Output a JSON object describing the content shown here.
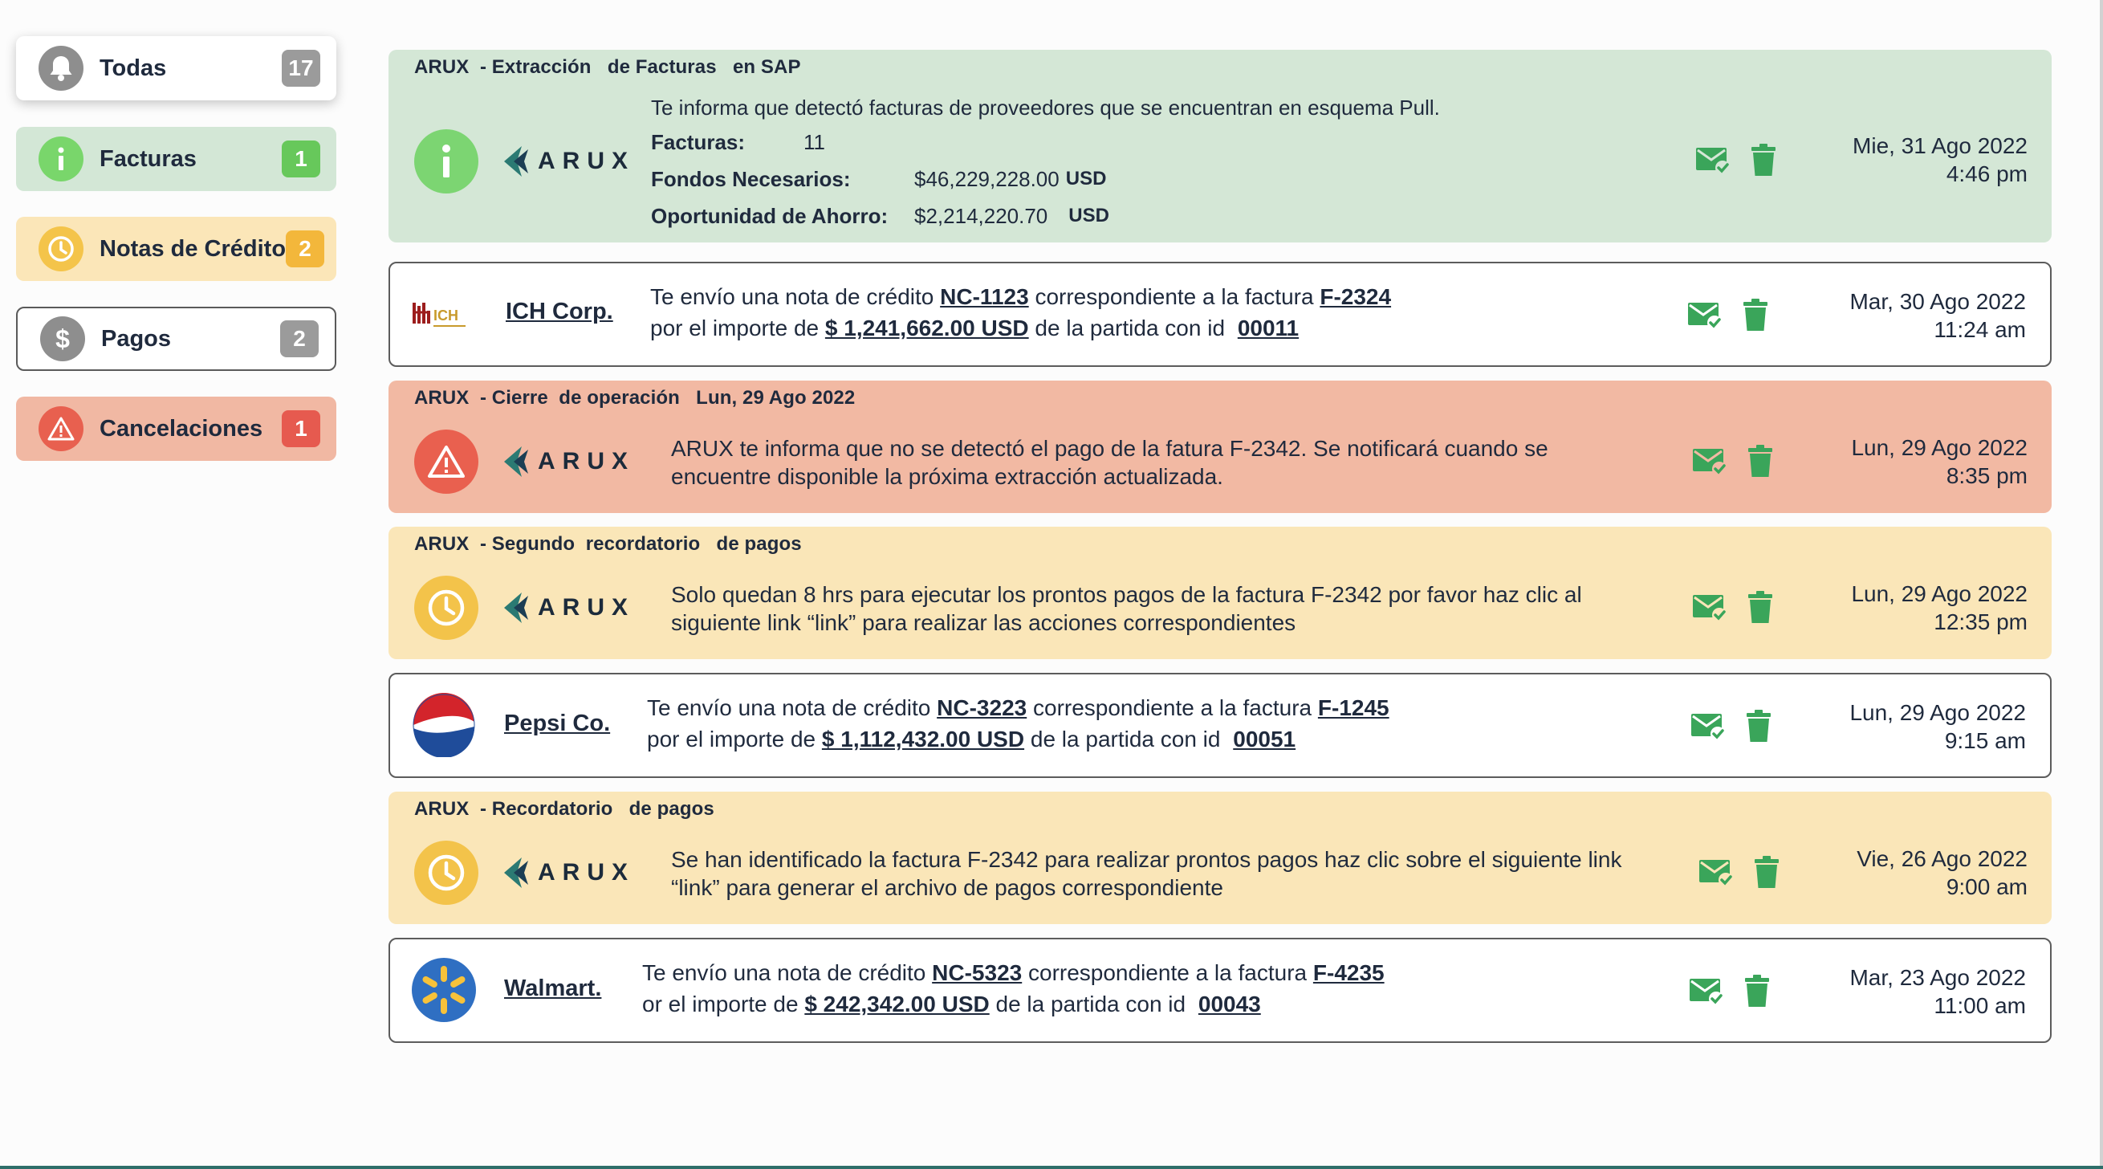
{
  "sidebar": {
    "filters": [
      {
        "label": "Todas",
        "count": "17"
      },
      {
        "label": "Facturas",
        "count": "1"
      },
      {
        "label": "Notas de Crédito",
        "count": "2"
      },
      {
        "label": "Pagos",
        "count": "2"
      },
      {
        "label": "Cancelaciones",
        "count": "1"
      }
    ]
  },
  "colors": {
    "green_bg": "#d4e7d6",
    "red_bg": "#f2b9a3",
    "yellow_bg": "#fae6b8",
    "action_green": "#3aa55a",
    "info_icon": "#7cd572",
    "warning_icon": "#e9604f",
    "clock_icon": "#f3c34a"
  },
  "notifications": [
    {
      "type": "factura",
      "header": "ARUX  - Extracción   de Facturas   en SAP",
      "logo": "ARUX",
      "intro": "Te informa que detectó facturas de proveedores que se encuentran en esquema Pull.",
      "details": [
        {
          "label": "Facturas:",
          "value": "11",
          "unit": ""
        },
        {
          "label": "Fondos Necesarios:",
          "value": "$46,229,228.00",
          "unit": "USD"
        },
        {
          "label": "Oportunidad de Ahorro:",
          "value": "$2,214,220.70",
          "unit": "USD"
        }
      ],
      "date": "Mie, 31 Ago 2022",
      "time": "4:46 pm",
      "icon": "info-icon"
    },
    {
      "type": "nota_credito",
      "company": "ICH Corp.",
      "logo_text": "ICH",
      "l1_pre": "Te envío una nota de crédito ",
      "note_id": "NC-1123",
      "l1_mid": " correspondiente a la factura ",
      "invoice_id": "F-2324",
      "l2_pre": "por el importe de ",
      "amount": "$ 1,241,662.00 USD",
      "l2_mid": " de la partida con id ",
      "item_id": "00011",
      "date": "Mar, 30 Ago 2022",
      "time": "11:24 am"
    },
    {
      "type": "cancelacion",
      "header": "ARUX  - Cierre  de operación   Lun, 29 Ago 2022",
      "logo": "ARUX",
      "lines": [
        "ARUX te informa que no se detectó el pago de la fatura F-2342. Se notificará cuando se",
        "encuentre disponible la próxima extracción actualizada."
      ],
      "date": "Lun, 29 Ago 2022",
      "time": "8:35 pm",
      "icon": "warning-icon"
    },
    {
      "type": "recordatorio",
      "header": "ARUX  - Segundo  recordatorio   de pagos",
      "logo": "ARUX",
      "lines": [
        "Solo quedan 8 hrs para ejecutar los prontos pagos de la factura F-2342 por favor haz clic al",
        "siguiente link “link” para realizar las acciones correspondientes"
      ],
      "date": "Lun, 29 Ago 2022",
      "time": "12:35 pm",
      "icon": "clock-icon"
    },
    {
      "type": "nota_credito",
      "company": "Pepsi Co.",
      "l1_pre": "Te envío una nota de crédito ",
      "note_id": "NC-3223",
      "l1_mid": " correspondiente a la factura ",
      "invoice_id": "F-1245",
      "l2_pre": "por el importe de ",
      "amount": "$ 1,112,432.00 USD",
      "l2_mid": " de la partida con id ",
      "item_id": "00051",
      "date": "Lun, 29 Ago 2022",
      "time": "9:15 am"
    },
    {
      "type": "recordatorio",
      "header": "ARUX  - Recordatorio   de pagos",
      "logo": "ARUX",
      "lines": [
        "Se han identificado la factura F-2342 para realizar prontos pagos haz clic sobre el siguiente link",
        "“link” para generar el archivo de pagos correspondiente"
      ],
      "date": "Vie, 26 Ago 2022",
      "time": "9:00 am",
      "icon": "clock-icon"
    },
    {
      "type": "nota_credito",
      "company": "Walmart.",
      "l1_pre": "Te envío una nota de crédito ",
      "note_id": "NC-5323",
      "l1_mid": " correspondiente a la factura ",
      "invoice_id": "F-4235",
      "l2_pre": "or el importe de ",
      "amount": "$ 242,342.00 USD",
      "l2_mid": " de la partida con id ",
      "item_id": "00043",
      "date": "Mar, 23 Ago 2022",
      "time": "11:00 am"
    }
  ]
}
